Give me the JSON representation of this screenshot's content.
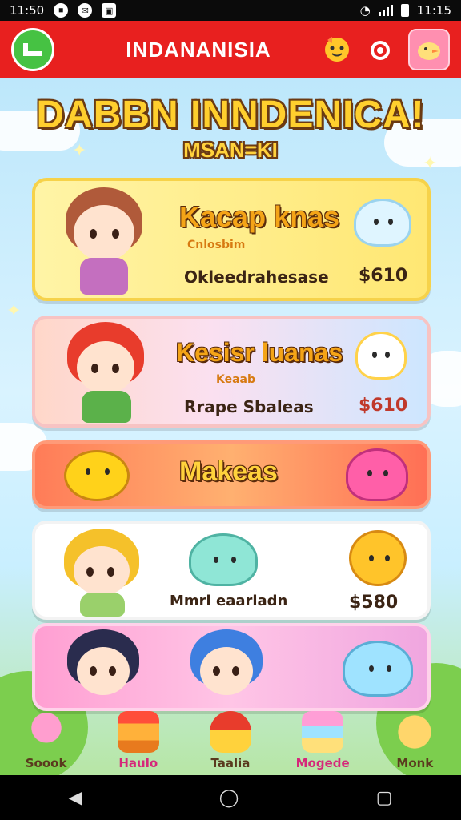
{
  "status_bar": {
    "time_left": "11:50",
    "time_right": "11:15"
  },
  "app_bar": {
    "title": "INDANANISIA"
  },
  "hero": {
    "title": "DABBN INNDENICA!",
    "subtitle": "MSAN=KI"
  },
  "cards": [
    {
      "title": "Kacap knas",
      "tag": "Cnlosbim",
      "desc": "Okleedrahesase",
      "price": "$610"
    },
    {
      "title": "Kesisr luanas",
      "tag": "Keaab",
      "desc": "Rrape Sbaleas",
      "price": "$610"
    },
    {
      "title": "Makeas"
    },
    {
      "desc": "Mmri eaariadn",
      "price": "$580"
    },
    {}
  ],
  "bottom_nav": [
    {
      "label": "Soook"
    },
    {
      "label": "Haulo"
    },
    {
      "label": "Taalia"
    },
    {
      "label": "Mogede"
    },
    {
      "label": "Monk"
    }
  ],
  "colors": {
    "app_bar": "#e8201f",
    "back_button": "#46c243",
    "accent_yellow": "#ffcf2e"
  }
}
